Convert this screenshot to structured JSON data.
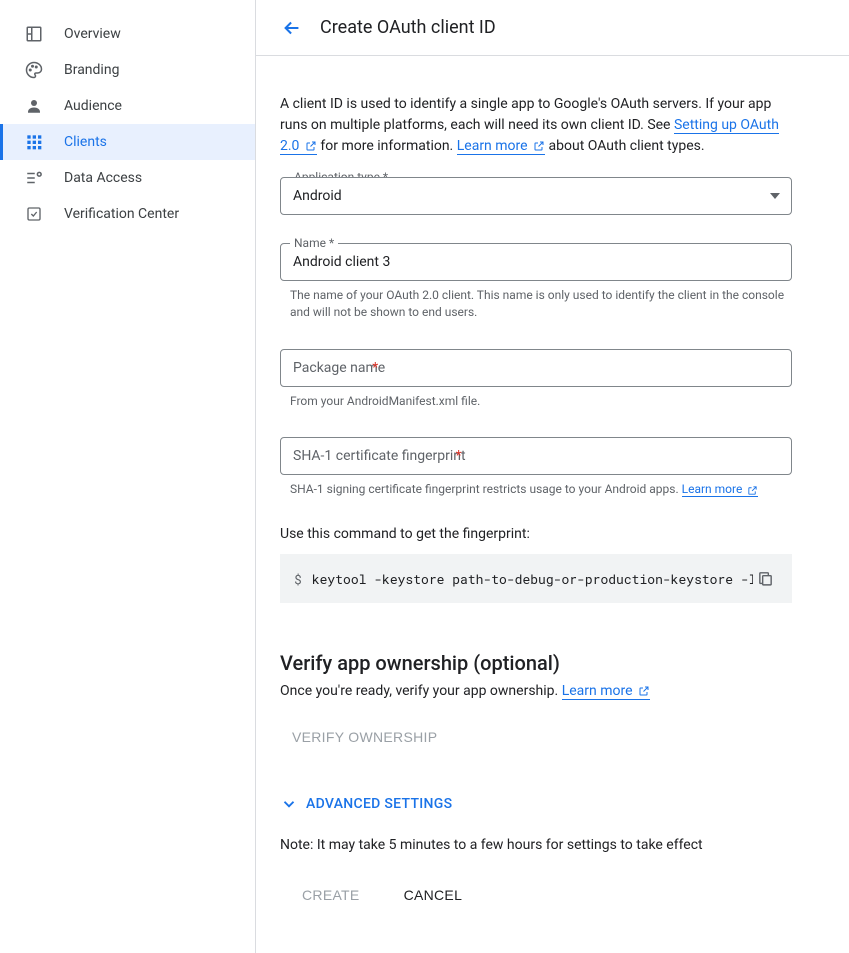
{
  "sidebar": {
    "items": [
      {
        "label": "Overview"
      },
      {
        "label": "Branding"
      },
      {
        "label": "Audience"
      },
      {
        "label": "Clients"
      },
      {
        "label": "Data Access"
      },
      {
        "label": "Verification Center"
      }
    ]
  },
  "header": {
    "title": "Create OAuth client ID"
  },
  "intro": {
    "part1": "A client ID is used to identify a single app to Google's OAuth servers. If your app runs on multiple platforms, each will need its own client ID. See ",
    "link1": "Setting up OAuth 2.0",
    "part2": " for more information. ",
    "link2": "Learn more",
    "part3": " about OAuth client types."
  },
  "form": {
    "appType": {
      "label": "Application type",
      "value": "Android"
    },
    "name": {
      "label": "Name",
      "value": "Android client 3",
      "helper": "The name of your OAuth 2.0 client. This name is only used to identify the client in the console and will not be shown to end users."
    },
    "package": {
      "placeholder": "Package name",
      "helper": "From your AndroidManifest.xml file."
    },
    "sha1": {
      "placeholder": "SHA-1 certificate fingerprint",
      "helper": "SHA-1 signing certificate fingerprint restricts usage to your Android apps. ",
      "helperLink": "Learn more"
    },
    "cmdLabel": "Use this command to get the fingerprint:",
    "cmd": "keytool -keystore path-to-debug-or-production-keystore -list"
  },
  "verify": {
    "title": "Verify app ownership (optional)",
    "sub": "Once you're ready, verify your app ownership. ",
    "subLink": "Learn more",
    "button": "Verify Ownership"
  },
  "advanced": {
    "label": "ADVANCED SETTINGS"
  },
  "note": "Note: It may take 5 minutes to a few hours for settings to take effect",
  "actions": {
    "create": "Create",
    "cancel": "Cancel"
  }
}
